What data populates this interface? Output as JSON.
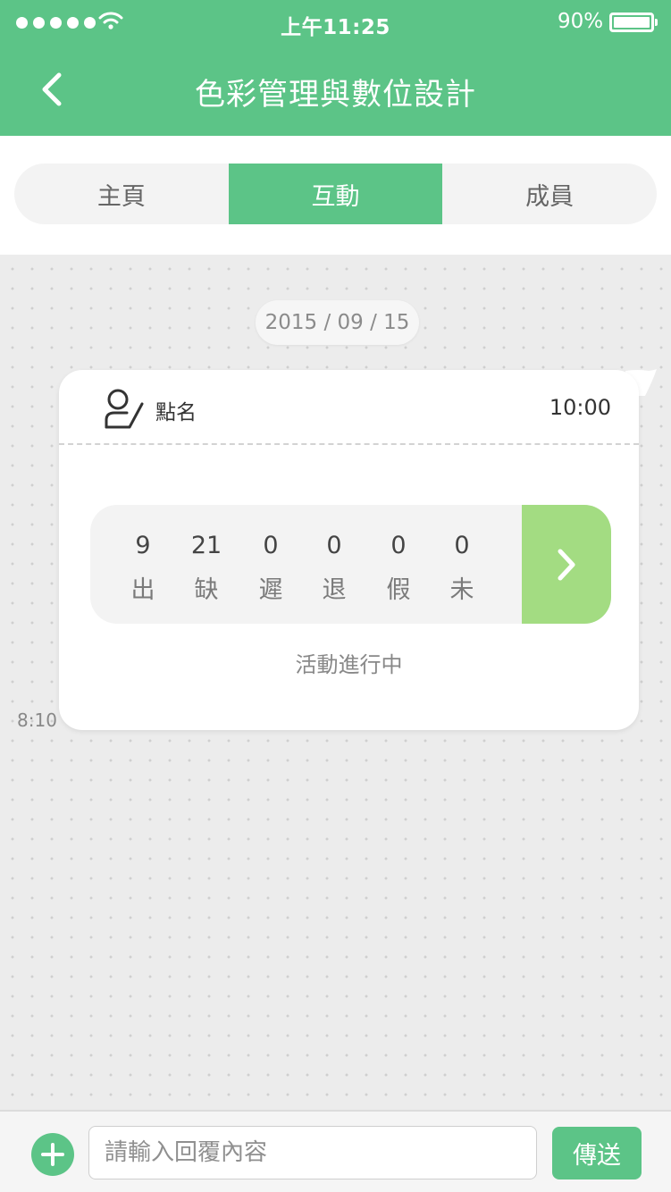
{
  "status_bar": {
    "time": "上午11:25",
    "battery_percent": "90%",
    "battery_level": 0.9,
    "icons": [
      "signal-dots-icon",
      "wifi-icon",
      "battery-icon"
    ]
  },
  "nav": {
    "title": "色彩管理與數位設計",
    "back_icon": "chevron-left-icon"
  },
  "tabs": [
    {
      "label": "主頁",
      "active": false
    },
    {
      "label": "互動",
      "active": true
    },
    {
      "label": "成員",
      "active": false
    }
  ],
  "chat": {
    "date": "2015 / 09 / 15",
    "message_time": "8:10",
    "card": {
      "icon": "person-check-icon",
      "title": "點名",
      "time": "10:00",
      "stats": [
        {
          "value": "9",
          "label": "出"
        },
        {
          "value": "21",
          "label": "缺"
        },
        {
          "value": "0",
          "label": "遲"
        },
        {
          "value": "0",
          "label": "退"
        },
        {
          "value": "0",
          "label": "假"
        },
        {
          "value": "0",
          "label": "未"
        }
      ],
      "go_icon": "chevron-right-icon",
      "status": "活動進行中"
    }
  },
  "input_bar": {
    "add_icon": "plus-icon",
    "placeholder": "請輸入回覆內容",
    "value": "",
    "send_label": "傳送"
  },
  "colors": {
    "brand_green": "#5cc487",
    "light_green": "#a3dc82",
    "background": "#ececec"
  }
}
